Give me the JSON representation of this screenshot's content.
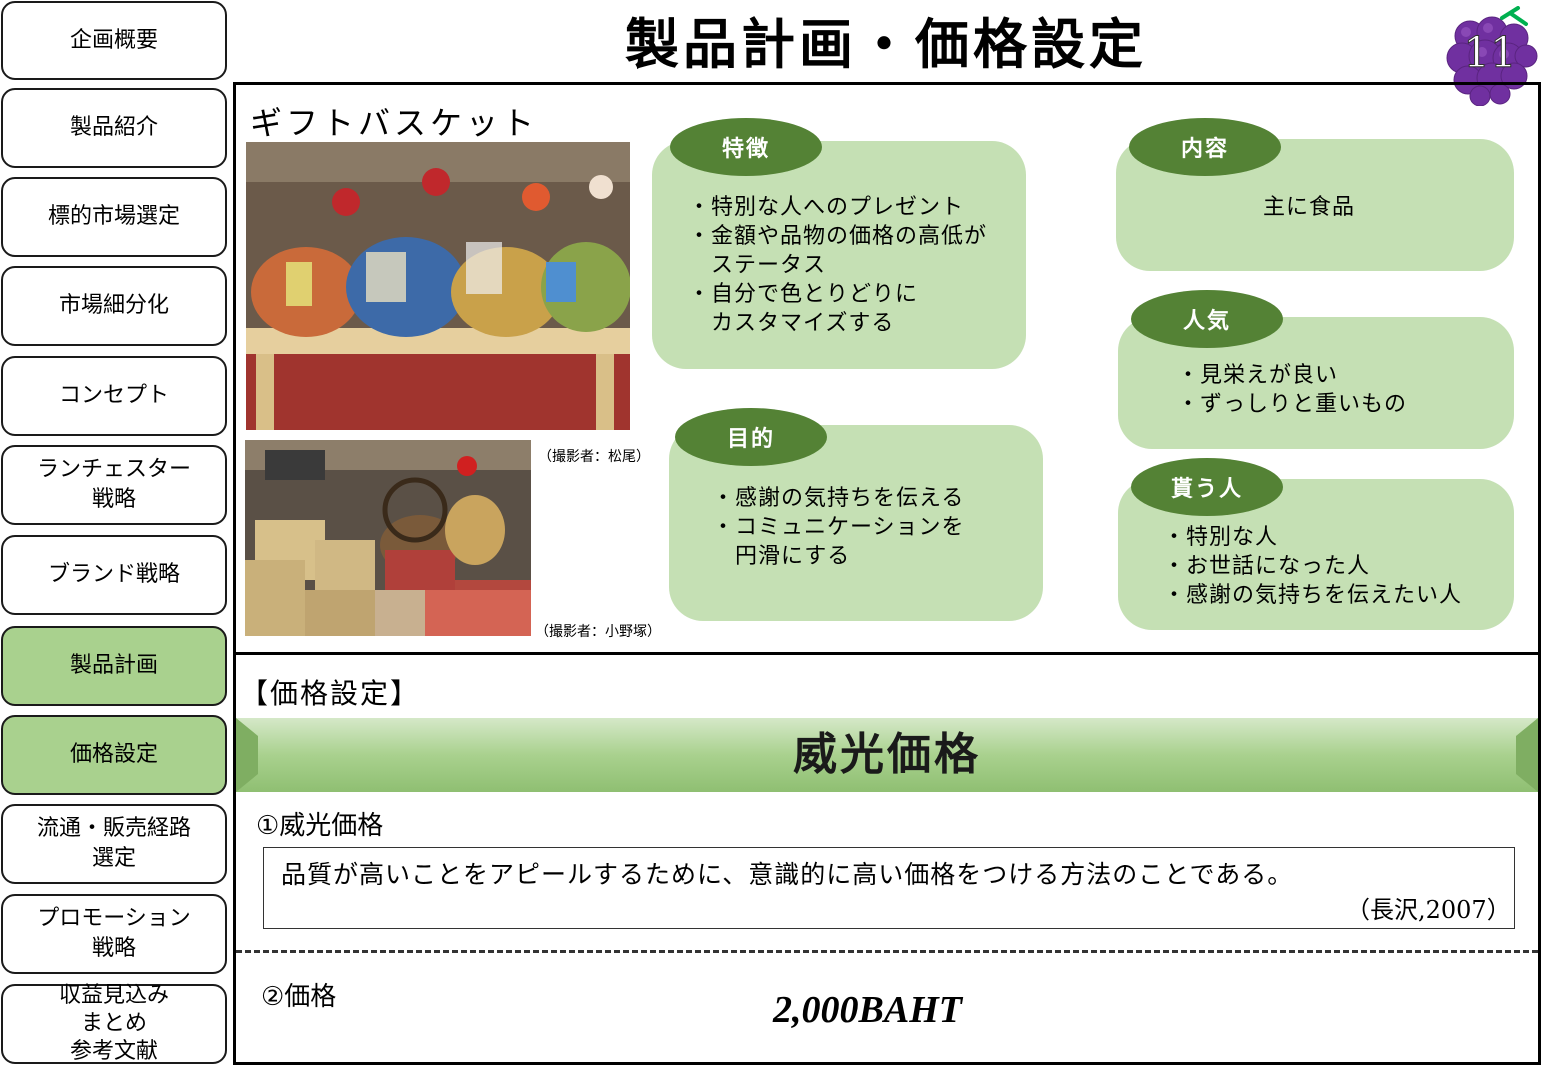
{
  "sidebar": {
    "items": [
      {
        "label": "企画概要",
        "active": false
      },
      {
        "label": "製品紹介",
        "active": false
      },
      {
        "label": "標的市場選定",
        "active": false
      },
      {
        "label": "市場細分化",
        "active": false
      },
      {
        "label": "コンセプト",
        "active": false
      },
      {
        "label": "ランチェスター\n戦略",
        "active": false
      },
      {
        "label": "ブランド戦略",
        "active": false
      },
      {
        "label": "製品計画",
        "active": true
      },
      {
        "label": "価格設定",
        "active": true
      },
      {
        "label": "流通・販売経路\n選定",
        "active": false
      },
      {
        "label": "プロモーション\n戦略",
        "active": false
      },
      {
        "label": "収益見込み\nまとめ\n参考文献",
        "active": false
      }
    ]
  },
  "header": {
    "title": "製品計画・価格設定",
    "page_number": "11"
  },
  "product": {
    "title": "ギフトバスケット",
    "photo_caption_1": "（撮影者：松尾）",
    "photo_caption_2": "（撮影者：小野塚）",
    "features": {
      "tab": "特徴",
      "text": "・特別な人へのプレゼント\n・金額や品物の価格の高低が\n　ステータス\n・自分で色とりどりに\n　カスタマイズする"
    },
    "purpose": {
      "tab": "目的",
      "text": "・感謝の気持ちを伝える\n・コミュニケーションを\n　円滑にする"
    },
    "contents": {
      "tab": "内容",
      "text": "主に食品"
    },
    "popularity": {
      "tab": "人気",
      "text": "・見栄えが良い\n・ずっしりと重いもの"
    },
    "recipients": {
      "tab": "貰う人",
      "text": "・特別な人\n・お世話になった人\n・感謝の気持ちを伝えたい人"
    }
  },
  "pricing": {
    "heading": "【価格設定】",
    "banner": "威光価格",
    "item1_title": "①威光価格",
    "definition": "品質が高いことをアピールするために、意識的に高い価格をつける方法のことである。",
    "citation": "（長沢,2007）",
    "item2_title": "②価格",
    "price": "2,000BAHT"
  },
  "colors": {
    "active_nav": "#a9d18e",
    "bubble": "#c5e0b4",
    "bubble_tab": "#548235",
    "banner": "#a9d18e",
    "badge": "#7030a0"
  }
}
